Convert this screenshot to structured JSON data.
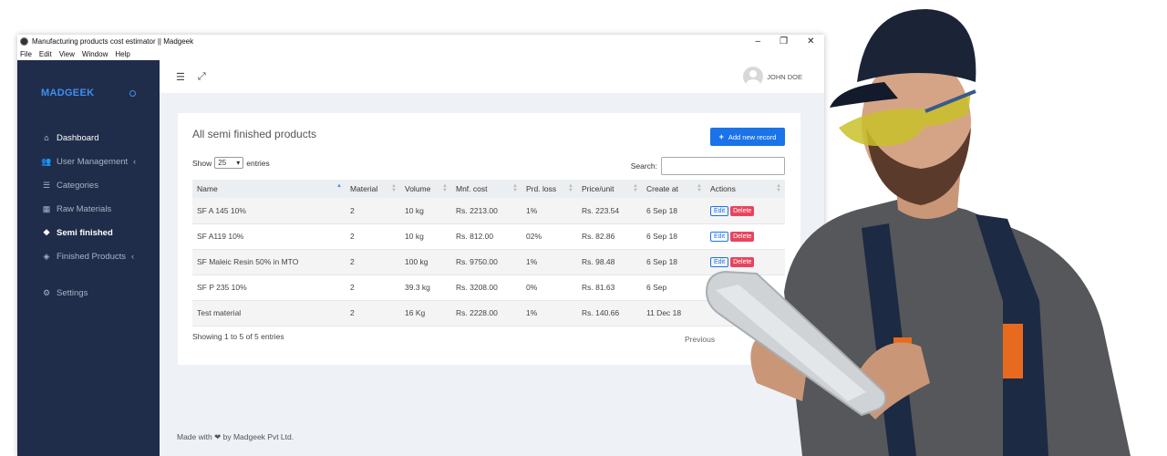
{
  "window": {
    "title": "Manufacturing products cost estimator || Madgeek",
    "controls": [
      "–",
      "❐",
      "✕"
    ]
  },
  "menu": [
    "File",
    "Edit",
    "View",
    "Window",
    "Help"
  ],
  "sidebar": {
    "brand": "MADGEEK",
    "items": [
      {
        "label": "Dashboard",
        "icon": "home-icon"
      },
      {
        "label": "User Management",
        "icon": "users-icon"
      },
      {
        "label": "Categories",
        "icon": "list-icon"
      },
      {
        "label": "Raw Materials",
        "icon": "grid-icon"
      },
      {
        "label": "Semi finished",
        "icon": "cubes-icon"
      },
      {
        "label": "Finished Products",
        "icon": "cube-icon"
      },
      {
        "label": "Settings",
        "icon": "gear-icon"
      }
    ]
  },
  "topbar": {
    "user": "JOHN DOE"
  },
  "card": {
    "title": "All semi finished products",
    "add_button": "Add new record",
    "show_label": "Show",
    "page_size": "25",
    "entries_label": "entries",
    "search_label": "Search:",
    "info": "Showing 1 to 5 of 5 entries",
    "pager_prev": "Previous"
  },
  "table": {
    "headers": [
      "Name",
      "Material",
      "Volume",
      "Mnf. cost",
      "Prd. loss",
      "Price/unit",
      "Create at",
      "Actions"
    ],
    "rows": [
      [
        "SF A 145 10%",
        "2",
        "10 kg",
        "Rs. 2213.00",
        "1%",
        "Rs. 223.54",
        "6 Sep 18"
      ],
      [
        "SF A119 10%",
        "2",
        "10 kg",
        "Rs. 812.00",
        "02%",
        "Rs. 82.86",
        "6 Sep 18"
      ],
      [
        "SF Maleic Resin 50% in MTO",
        "2",
        "100 kg",
        "Rs. 9750.00",
        "1%",
        "Rs. 98.48",
        "6 Sep 18"
      ],
      [
        "SF P 235 10%",
        "2",
        "39.3 kg",
        "Rs. 3208.00",
        "0%",
        "Rs. 81.63",
        "6 Sep"
      ],
      [
        "Test material",
        "2",
        "16 Kg",
        "Rs. 2228.00",
        "1%",
        "Rs. 140.66",
        "11 Dec 18"
      ]
    ],
    "edit_label": "Edit",
    "delete_label": "Delete"
  },
  "footer": {
    "prefix": "Made with",
    "suffix": "by Madgeek Pvt Ltd."
  },
  "colors": {
    "sidebar": "#1f2d4a",
    "accent": "#1a73e8",
    "danger": "#e8455d"
  }
}
